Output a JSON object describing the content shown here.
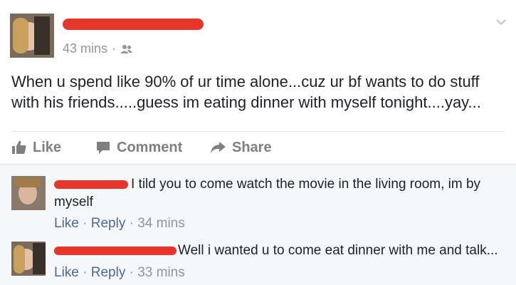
{
  "post": {
    "timestamp": "43 mins",
    "separator": "·",
    "audience_icon": "friends-icon",
    "text": "When u spend like 90% of ur time alone...cuz ur bf wants to do stuff with his friends.....guess im eating dinner with myself tonight....yay...",
    "menu_icon": "chevron-down-icon"
  },
  "actions": {
    "like_label": "Like",
    "comment_label": "Comment",
    "share_label": "Share"
  },
  "comments": [
    {
      "text_line1": "I tild you to come watch the movie in the living room, im by",
      "text_line2": "myself",
      "like_label": "Like",
      "reply_label": "Reply",
      "time": "34 mins",
      "sep": " · "
    },
    {
      "text_line1": "Well i wanted u to come eat dinner with me and talk...",
      "like_label": "Like",
      "reply_label": "Reply",
      "time": "33 mins",
      "sep": " · "
    }
  ],
  "colors": {
    "redaction": "#e8352b",
    "link": "#4b67a1",
    "meta": "#90949c"
  }
}
